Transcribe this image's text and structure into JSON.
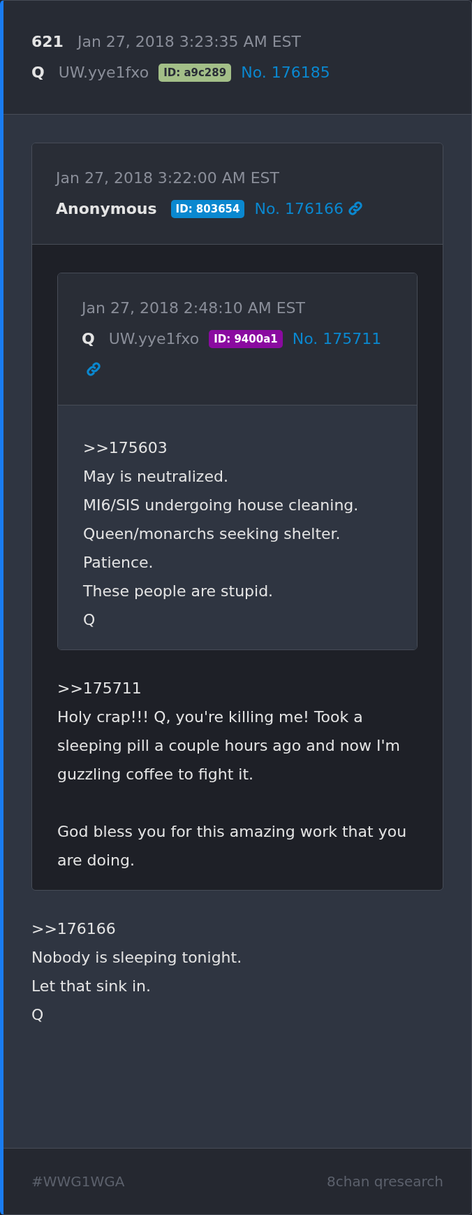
{
  "post": {
    "number": "621",
    "date": "Jan 27, 2018 3:23:35 AM EST",
    "name": "Q",
    "trip": "UW.yye1fxo",
    "id_badge": {
      "label": "ID: a9c289",
      "color": "#a3bf88"
    },
    "post_no": "No. 176185",
    "permalink": false,
    "quote": {
      "date": "Jan 27, 2018 3:22:00 AM EST",
      "name": "Anonymous",
      "id_badge": {
        "label": "ID: 803654",
        "color": "#0a88d0"
      },
      "post_no": "No. 176166",
      "permalink": true,
      "quote": {
        "date": "Jan 27, 2018 2:48:10 AM EST",
        "name": "Q",
        "trip": "UW.yye1fxo",
        "id_badge": {
          "label": "ID: 9400a1",
          "color": "#8a0aa0"
        },
        "post_no": "No. 175711",
        "permalink": true,
        "body": [
          ">>175603\nMay is neutralized.\nMI6/SIS undergoing house cleaning.\nQueen/monarchs seeking shelter.\nPatience.\nThese people are stupid.\nQ"
        ]
      },
      "body": [
        ">>175711\nHoly crap!!! Q, you're killing me! Took a sleeping pill a couple hours ago and now I'm guzzling coffee to fight it.",
        "God bless you for this amazing work that you are doing."
      ]
    },
    "body": [
      ">>176166\nNobody is sleeping tonight.\nLet that sink in.\nQ"
    ]
  },
  "footer": {
    "tag": "#WWG1WGA",
    "source": "8chan qresearch"
  }
}
